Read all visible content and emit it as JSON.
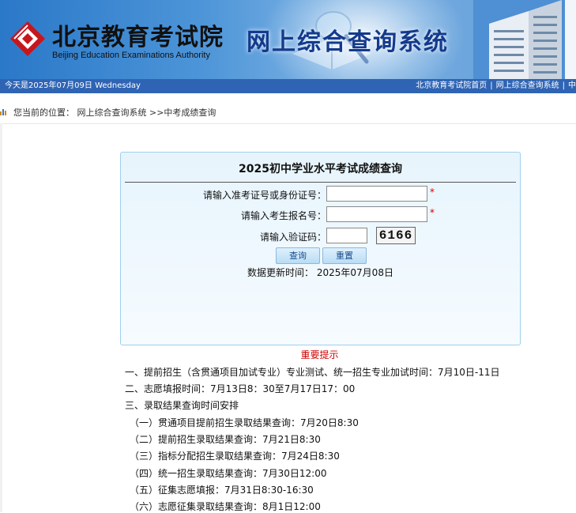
{
  "header": {
    "org_name_cn": "北京教育考试院",
    "org_name_en": "Beijing Education Examinations Authority",
    "system_title": "网上综合查询系统"
  },
  "topbar": {
    "date_text": "今天是2025年07月09日 Wednesday",
    "links": [
      "北京教育考试院首页",
      "网上综合查询系统",
      "中"
    ]
  },
  "breadcrumb": {
    "prefix": "您当前的位置：",
    "link": "网上综合查询系统",
    "current": ">>中考成绩查询"
  },
  "query_form": {
    "title": "2025初中学业水平考试成绩查询",
    "id_label": "请输入准考证号或身份证号：",
    "id_value": "",
    "name_label": "请输入考生报名号：",
    "name_value": "",
    "captcha_label": "请输入验证码：",
    "captcha_value": "",
    "captcha_code": "6166",
    "required_mark": "*",
    "submit_label": "查询",
    "reset_label": "重置",
    "update_label": "数据更新时间：",
    "update_date": "2025年07月08日"
  },
  "notice": {
    "title": "重要提示",
    "items": [
      "一、提前招生（含贯通项目加试专业）专业测试、统一招生专业加试时间：7月10日-11日",
      "二、志愿填报时间：7月13日8：30至7月17日17：00",
      "三、录取结果查询时间安排",
      "（一）贯通项目提前招生录取结果查询：7月20日8:30",
      "（二）提前招生录取结果查询：7月21日8:30",
      "（三）指标分配招生录取结果查询：7月24日8:30",
      "（四）统一招生录取结果查询：7月30日12:00",
      "（五）征集志愿填报：7月31日8:30-16:30",
      "（六）志愿征集录取结果查询：8月1日12:00"
    ]
  },
  "colors": {
    "banner_blue": "#2a78c8",
    "nav_bar": "#2f64b4",
    "title_blue": "#143a8c",
    "panel_border": "#9ed0ec",
    "required_red": "#d20000"
  }
}
